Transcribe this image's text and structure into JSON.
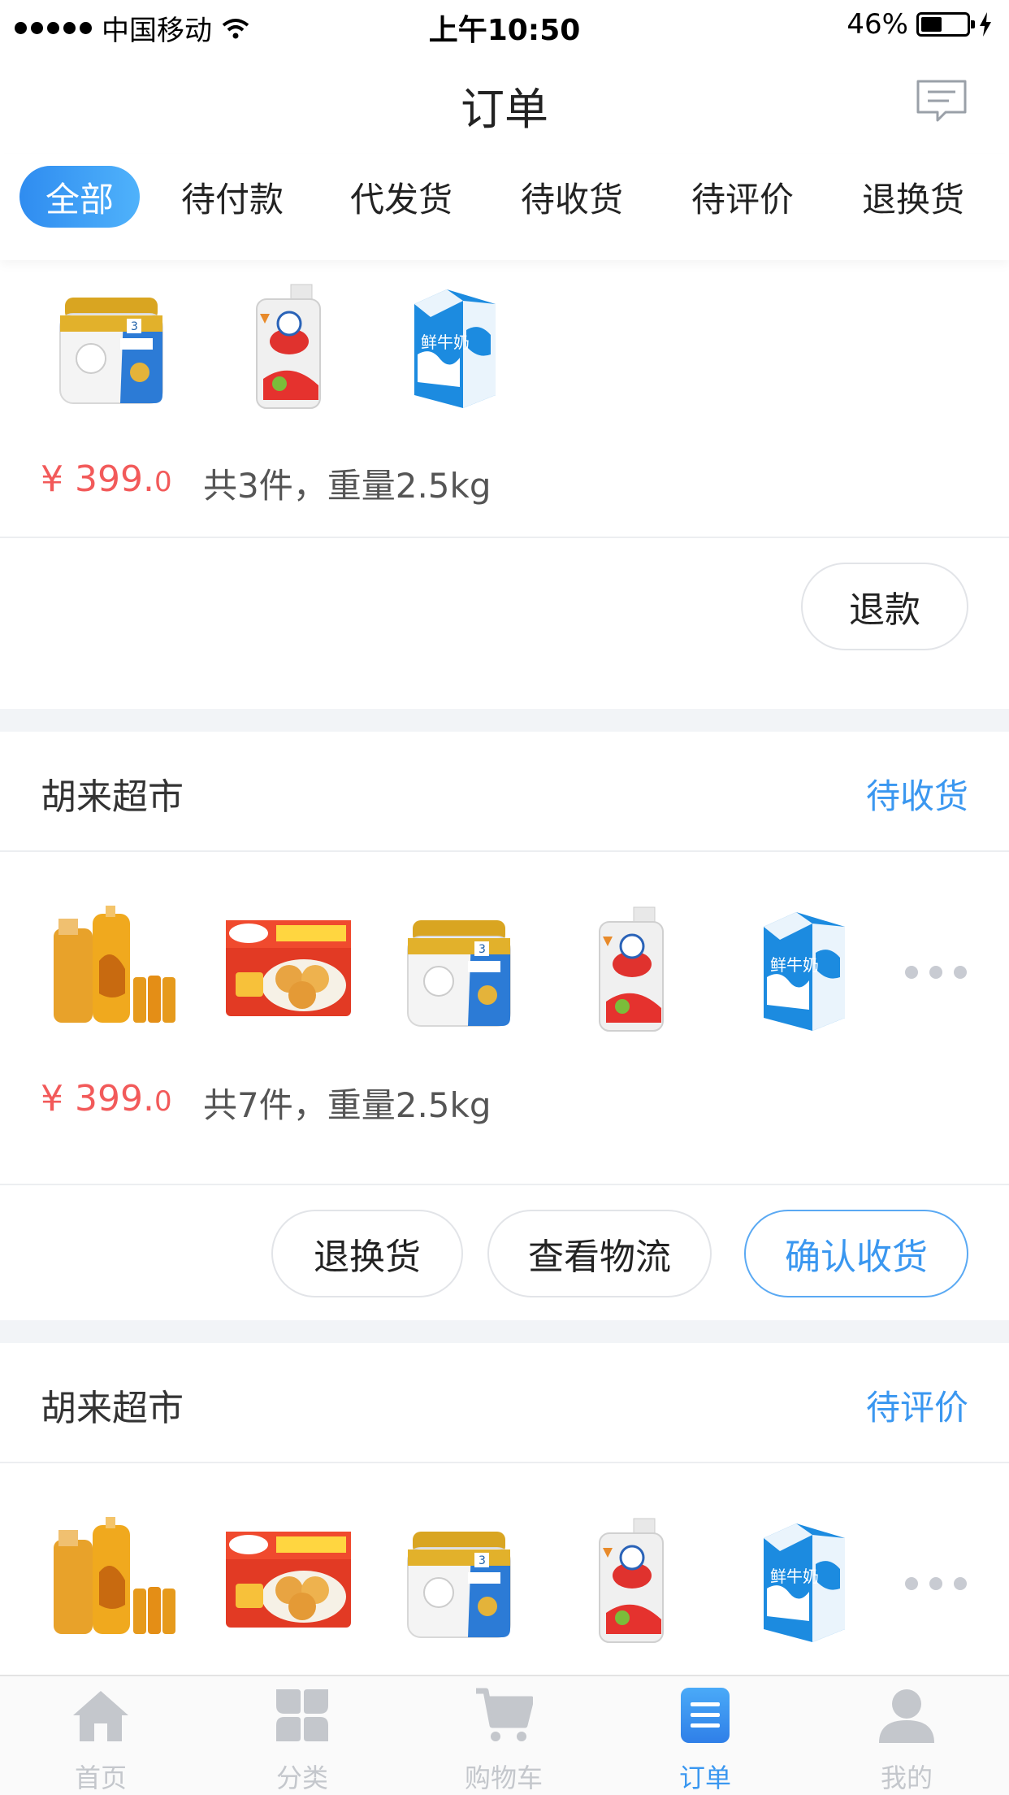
{
  "status_bar": {
    "carrier": "中国移动",
    "time": "上午10:50",
    "battery": "46%",
    "battery_level": 0.46
  },
  "header": {
    "title": "订单"
  },
  "tabs": [
    {
      "label": "全部",
      "active": true
    },
    {
      "label": "待付款",
      "active": false
    },
    {
      "label": "代发货",
      "active": false
    },
    {
      "label": "待收货",
      "active": false
    },
    {
      "label": "待评价",
      "active": false
    },
    {
      "label": "退换货",
      "active": false
    }
  ],
  "orders": [
    {
      "products": [
        "similac-milk-powder",
        "dish-soap",
        "fresh-milk"
      ],
      "price_main": "¥ 399.",
      "price_decimal": "0",
      "summary": "共3件，重量2.5kg",
      "buttons": [
        "退款"
      ]
    },
    {
      "shop": "胡来超市",
      "status": "待收货",
      "products": [
        "shampoo",
        "egg-cake",
        "similac-milk-powder",
        "dish-soap",
        "fresh-milk"
      ],
      "price_main": "¥ 399.",
      "price_decimal": "0",
      "summary": "共7件，重量2.5kg",
      "buttons": [
        "退换货",
        "查看物流",
        "确认收货"
      ]
    },
    {
      "shop": "胡来超市",
      "status": "待评价",
      "products": [
        "shampoo",
        "egg-cake",
        "similac-milk-powder",
        "dish-soap",
        "fresh-milk"
      ]
    }
  ],
  "tabbar": [
    {
      "label": "首页",
      "icon": "home-icon",
      "active": false
    },
    {
      "label": "分类",
      "icon": "category-icon",
      "active": false
    },
    {
      "label": "购物车",
      "icon": "cart-icon",
      "active": false
    },
    {
      "label": "订单",
      "icon": "order-icon",
      "active": true
    },
    {
      "label": "我的",
      "icon": "profile-icon",
      "active": false
    }
  ],
  "colors": {
    "accent": "#3a97f0",
    "price": "#f25a5a",
    "inactive": "#c4c7cc"
  }
}
